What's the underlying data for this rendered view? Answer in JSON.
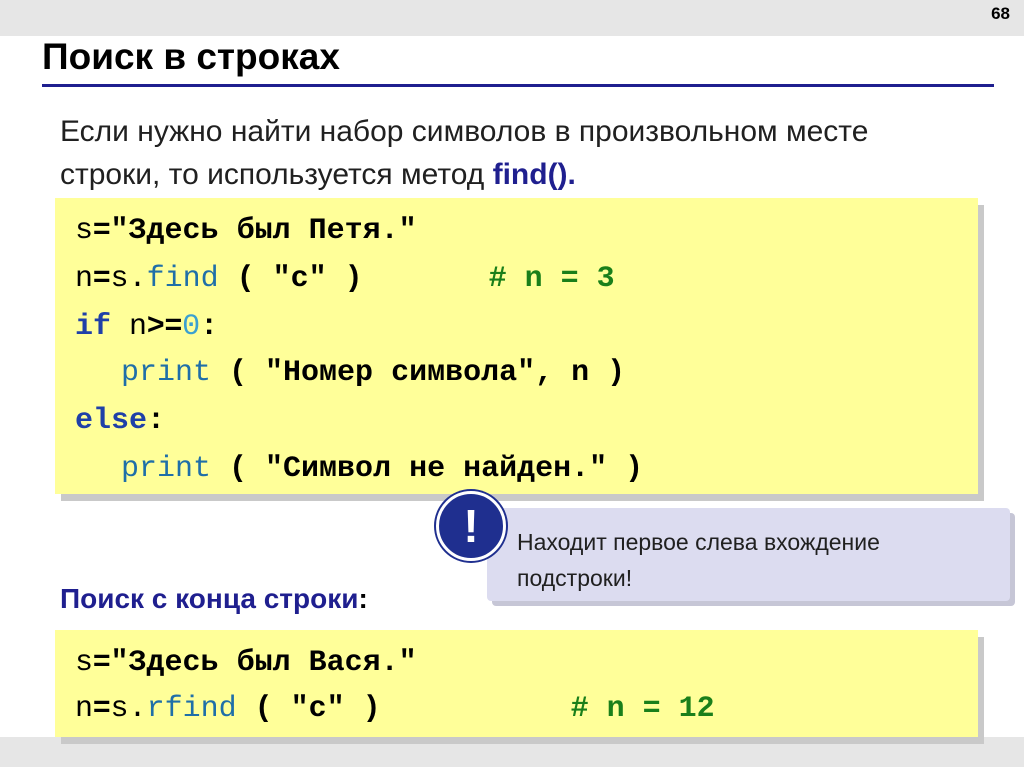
{
  "slide_number": "68",
  "title": "Поиск в строках",
  "intro": {
    "text": "Если нужно найти набор символов в произвольном месте строки, то используется метод ",
    "method": "find()."
  },
  "code1": {
    "line1": {
      "var": "s",
      "op": "=",
      "str": "\"Здесь был Петя.\""
    },
    "line2": {
      "var": "n",
      "op": "=",
      "obj": "s.",
      "fn": "find",
      "args": "( \"с\" )",
      "comment": "# n = 3"
    },
    "line3": {
      "kw": "if",
      "var": "n",
      "op": ">=",
      "num": "0",
      "colon": ":"
    },
    "line4": {
      "fn": "print",
      "args_open": "( ",
      "str": "\"Номер символа\"",
      "rest": ", n )"
    },
    "line5": {
      "kw": "else",
      "colon": ":"
    },
    "line6": {
      "fn": "print",
      "args_open": "( ",
      "str": "\"Символ не найден.\"",
      "rest": " )"
    }
  },
  "note": {
    "icon_text": "!",
    "text": "Находит первое слева вхождение подстроки!"
  },
  "subhead": {
    "text": "Поиск с конца строки",
    "colon": ":"
  },
  "code2": {
    "line1": {
      "var": "s",
      "op": "=",
      "str": "\"Здесь был Вася.\""
    },
    "line2": {
      "var": "n",
      "op": "=",
      "obj": "s.",
      "fn": "rfind",
      "args": "( \"с\" )",
      "comment": "# n = 12"
    }
  },
  "colors": {
    "accent": "#1f1f8f",
    "code_bg": "#ffff99",
    "note_bg": "#dcdcf0",
    "comment": "#1a7f1a"
  }
}
